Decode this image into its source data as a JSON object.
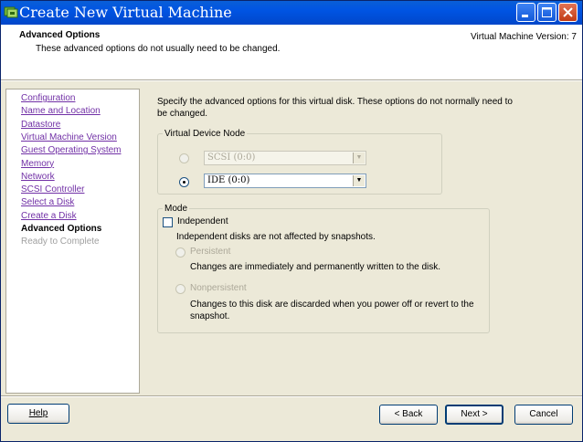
{
  "window": {
    "title": "Create New Virtual Machine"
  },
  "header": {
    "title": "Advanced Options",
    "subtitle": "These advanced options do not usually need to be changed.",
    "version": "Virtual Machine Version: 7"
  },
  "nav": {
    "items": [
      {
        "label": "Configuration",
        "state": "link"
      },
      {
        "label": "Name and Location",
        "state": "link"
      },
      {
        "label": "Datastore",
        "state": "link"
      },
      {
        "label": "Virtual Machine Version",
        "state": "link"
      },
      {
        "label": "Guest Operating System",
        "state": "link"
      },
      {
        "label": "Memory",
        "state": "link"
      },
      {
        "label": "Network",
        "state": "link"
      },
      {
        "label": "SCSI Controller",
        "state": "link"
      },
      {
        "label": "Select a Disk",
        "state": "link"
      },
      {
        "label": "Create a Disk",
        "state": "link"
      },
      {
        "label": "Advanced Options",
        "state": "current"
      },
      {
        "label": "Ready to Complete",
        "state": "future"
      }
    ]
  },
  "content": {
    "instruction": "Specify the advanced options for this virtual disk. These options do not normally need to be changed.",
    "virtual_device_node": {
      "legend": "Virtual Device Node",
      "scsi_value": "SCSI (0:0)",
      "ide_value": "IDE (0:0)",
      "selected": "ide"
    },
    "mode": {
      "legend": "Mode",
      "independent_label": "Independent",
      "independent_checked": false,
      "independent_desc": "Independent disks are not affected by snapshots.",
      "persistent_label": "Persistent",
      "persistent_desc": "Changes are immediately and permanently written to the disk.",
      "nonpersistent_label": "Nonpersistent",
      "nonpersistent_desc": "Changes to this disk are discarded when you power off or revert to the snapshot."
    }
  },
  "footer": {
    "help": "Help",
    "back": "< Back",
    "next": "Next >",
    "cancel": "Cancel"
  },
  "colors": {
    "titlebar": "#0054E3",
    "link": "#7130A6",
    "disabled_text": "#ACA899"
  },
  "icons": [
    "vm-wizard-icon",
    "minimize-icon",
    "maximize-icon",
    "close-icon",
    "dropdown-arrow-icon"
  ]
}
